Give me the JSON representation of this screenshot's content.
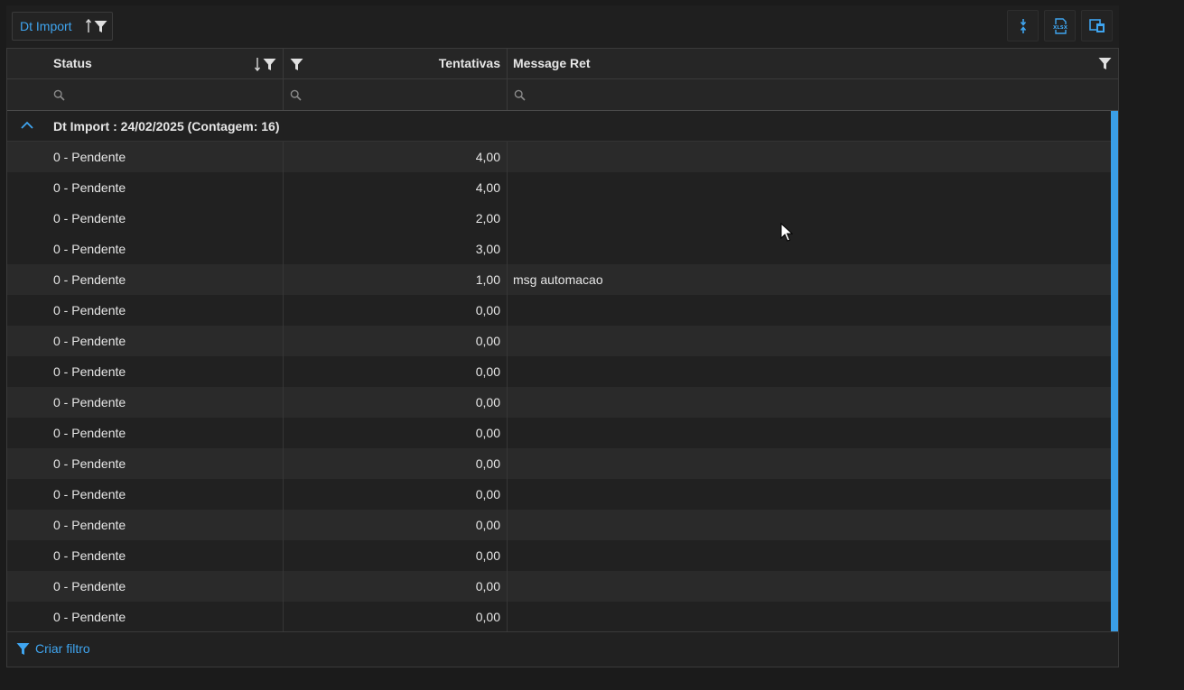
{
  "group_panel": {
    "chip_label": "Dt Import"
  },
  "toolbar": {
    "collapse_icon": "collapse-arrows-icon",
    "export_icon": "xlsx-export-icon",
    "columns_icon": "column-chooser-icon"
  },
  "grid": {
    "columns": {
      "status": "Status",
      "tentativas": "Tentativas",
      "message": "Message Ret"
    },
    "group_row": {
      "label": "Dt Import : 24/02/2025 (Contagem: 16)"
    },
    "rows": [
      {
        "status": "0 - Pendente",
        "tentativas": "4,00",
        "message": ""
      },
      {
        "status": "0 - Pendente",
        "tentativas": "4,00",
        "message": ""
      },
      {
        "status": "0 - Pendente",
        "tentativas": "2,00",
        "message": ""
      },
      {
        "status": "0 - Pendente",
        "tentativas": "3,00",
        "message": ""
      },
      {
        "status": "0 - Pendente",
        "tentativas": "1,00",
        "message": "msg automacao"
      },
      {
        "status": "0 - Pendente",
        "tentativas": "0,00",
        "message": ""
      },
      {
        "status": "0 - Pendente",
        "tentativas": "0,00",
        "message": ""
      },
      {
        "status": "0 - Pendente",
        "tentativas": "0,00",
        "message": ""
      },
      {
        "status": "0 - Pendente",
        "tentativas": "0,00",
        "message": ""
      },
      {
        "status": "0 - Pendente",
        "tentativas": "0,00",
        "message": ""
      },
      {
        "status": "0 - Pendente",
        "tentativas": "0,00",
        "message": ""
      },
      {
        "status": "0 - Pendente",
        "tentativas": "0,00",
        "message": ""
      },
      {
        "status": "0 - Pendente",
        "tentativas": "0,00",
        "message": ""
      },
      {
        "status": "0 - Pendente",
        "tentativas": "0,00",
        "message": ""
      },
      {
        "status": "0 - Pendente",
        "tentativas": "0,00",
        "message": ""
      },
      {
        "status": "0 - Pendente",
        "tentativas": "0,00",
        "message": ""
      }
    ]
  },
  "footer": {
    "create_filter_label": "Criar filtro"
  },
  "colors": {
    "accent": "#3fa5f0",
    "background": "#1b1b1b",
    "row_alt": "#2a2a2a",
    "scrollbar": "#3a9ee6"
  }
}
